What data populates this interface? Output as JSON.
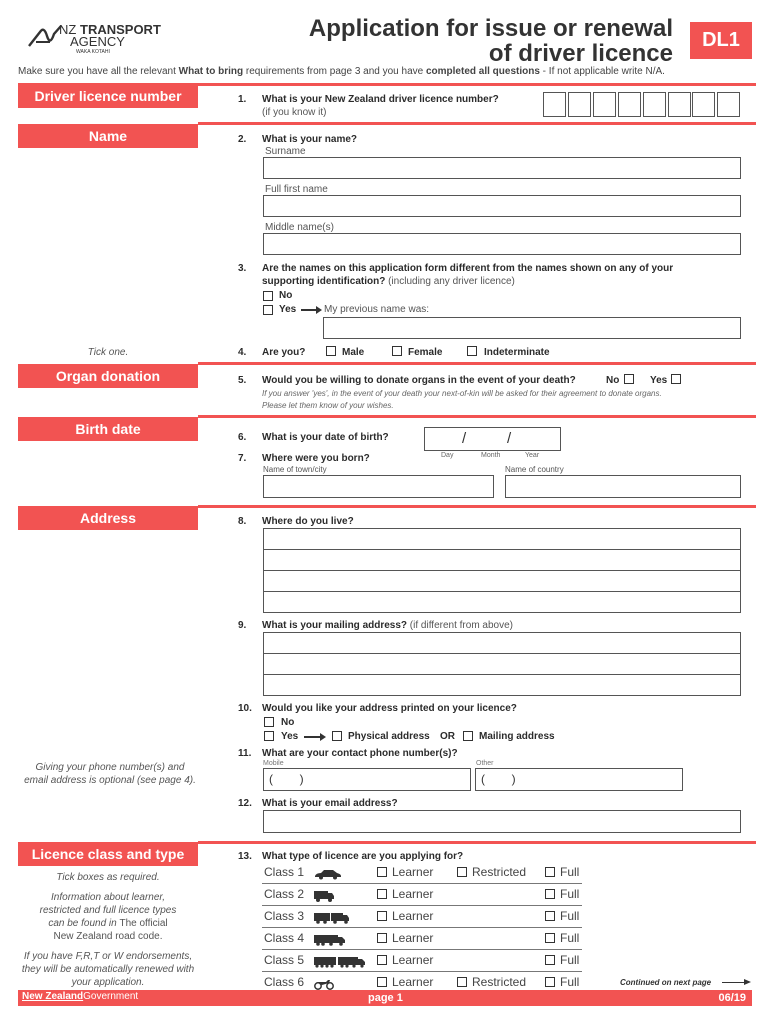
{
  "header": {
    "logo_nz": "NZ",
    "logo_transport": "TRANSPORT",
    "logo_agency": "AGENCY",
    "logo_waka": "WAKA KOTAHI",
    "title_line1": "Application for issue or renewal",
    "title_line2": "of driver licence",
    "form_code": "DL1",
    "instructions_pre": "Make sure you have all the relevant ",
    "instructions_bold1": "What to bring",
    "instructions_mid": " requirements from page 3 and you have ",
    "instructions_bold2": "completed all questions",
    "instructions_post": " - If not applicable write N/A."
  },
  "colors": {
    "accent": "#f25352",
    "text": "#2b2b2b"
  },
  "sections": {
    "driver_licence_number": "Driver licence number",
    "name": "Name",
    "organ_donation": "Organ donation",
    "birth_date": "Birth date",
    "address": "Address",
    "licence_class": "Licence class and type"
  },
  "q1": {
    "num": "1.",
    "text": "What is your New Zealand driver licence number?",
    "sub": "(if you know it)",
    "digit_count": 8
  },
  "q2": {
    "num": "2.",
    "text": "What is your name?",
    "surname": "Surname",
    "first": "Full first name",
    "middle": "Middle name(s)"
  },
  "q3": {
    "num": "3.",
    "text_line1": "Are the names on this application form different from the names shown on any of your",
    "text_line2_bold": "supporting identification?",
    "text_line2_norm": " (including any driver licence)",
    "no": "No",
    "yes": "Yes",
    "arrow": "⟶",
    "previous": "My previous name was:"
  },
  "q4": {
    "num": "4.",
    "side_note": "Tick one.",
    "text": "Are you?",
    "opt_male": "Male",
    "opt_female": "Female",
    "opt_indet": "Indeterminate"
  },
  "q5": {
    "num": "5.",
    "text": "Would you be willing to donate organs in the event of your death?",
    "no": "No",
    "yes": "Yes",
    "note_line1": "If you answer 'yes', in the event of your death your next-of-kin will be asked for their agreement to donate organs.",
    "note_line2": "Please let them know of your wishes."
  },
  "q6": {
    "num": "6.",
    "text": "What is your date of birth?",
    "slash": "/",
    "day": "Day",
    "month": "Month",
    "year": "Year"
  },
  "q7": {
    "num": "7.",
    "text": "Where were you born?",
    "town": "Name of town/city",
    "country": "Name of country"
  },
  "q8": {
    "num": "8.",
    "text": "Where do you live?"
  },
  "q9": {
    "num": "9.",
    "text": "What is your mailing address?",
    "sub": " (if different from above)"
  },
  "q10": {
    "num": "10.",
    "text": "Would you like your address printed on your licence?",
    "no": "No",
    "yes": "Yes",
    "physical": "Physical address",
    "or": "OR",
    "mailing": "Mailing address"
  },
  "q11": {
    "num": "11.",
    "text": "What are your contact phone number(s)?",
    "mobile": "Mobile",
    "other": "Other",
    "paren": "(        )",
    "side_note_line1": "Giving your phone number(s) and",
    "side_note_line2": "email address is optional (see page 4)."
  },
  "q12": {
    "num": "12.",
    "text": "What is your email address?"
  },
  "q13": {
    "num": "13.",
    "text": "What type of licence are you applying for?",
    "side_note1": "Tick boxes as required.",
    "side_note2_line1": "Information about learner,",
    "side_note2_line2": "restricted and full licence types",
    "side_note2_line3_italic": "can be found in ",
    "side_note2_line3_norm": "The official",
    "side_note2_line4": "New Zealand road code.",
    "side_note3_line1": "If you have F,R,T or W endorsements,",
    "side_note3_line2": "they will be automatically renewed with",
    "side_note3_line3": "your application.",
    "learner": "Learner",
    "restricted": "Restricted",
    "full": "Full",
    "classes": [
      {
        "label": "Class 1",
        "vehicle": "car-icon",
        "restricted": true
      },
      {
        "label": "Class 2",
        "vehicle": "truck-icon",
        "restricted": false
      },
      {
        "label": "Class 3",
        "vehicle": "truck-trailer-icon",
        "restricted": false
      },
      {
        "label": "Class 4",
        "vehicle": "heavy-truck-icon",
        "restricted": false
      },
      {
        "label": "Class 5",
        "vehicle": "heavy-combination-icon",
        "restricted": false
      },
      {
        "label": "Class 6",
        "vehicle": "motorcycle-icon",
        "restricted": true
      }
    ]
  },
  "footer": {
    "continued": "Continued on next page",
    "nzgov_1": "New Zealand",
    "nzgov_2": "Government",
    "page": "page 1",
    "version": "06/19"
  }
}
